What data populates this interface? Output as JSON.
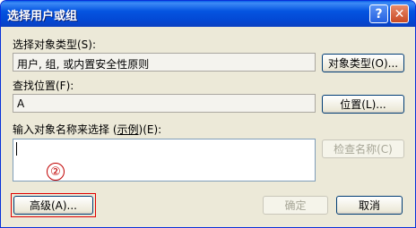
{
  "window": {
    "title": "选择用户或组",
    "help_glyph": "?",
    "close_glyph": "✕"
  },
  "object_type": {
    "label": "选择对象类型(S):",
    "value": "用户, 组, 或内置安全性原则",
    "button": "对象类型(O)..."
  },
  "location": {
    "label": "查找位置(F):",
    "value": "A",
    "button": "位置(L)..."
  },
  "names": {
    "label_prefix": "输入对象名称来选择 (",
    "label_link": "示例",
    "label_suffix": ")(E):",
    "value": "",
    "check_button": "检查名称(C)"
  },
  "annotation": {
    "marker": "②",
    "color": "#cc0000"
  },
  "footer": {
    "advanced_button": "高级(A)...",
    "ok_button": "确定",
    "cancel_button": "取消"
  }
}
